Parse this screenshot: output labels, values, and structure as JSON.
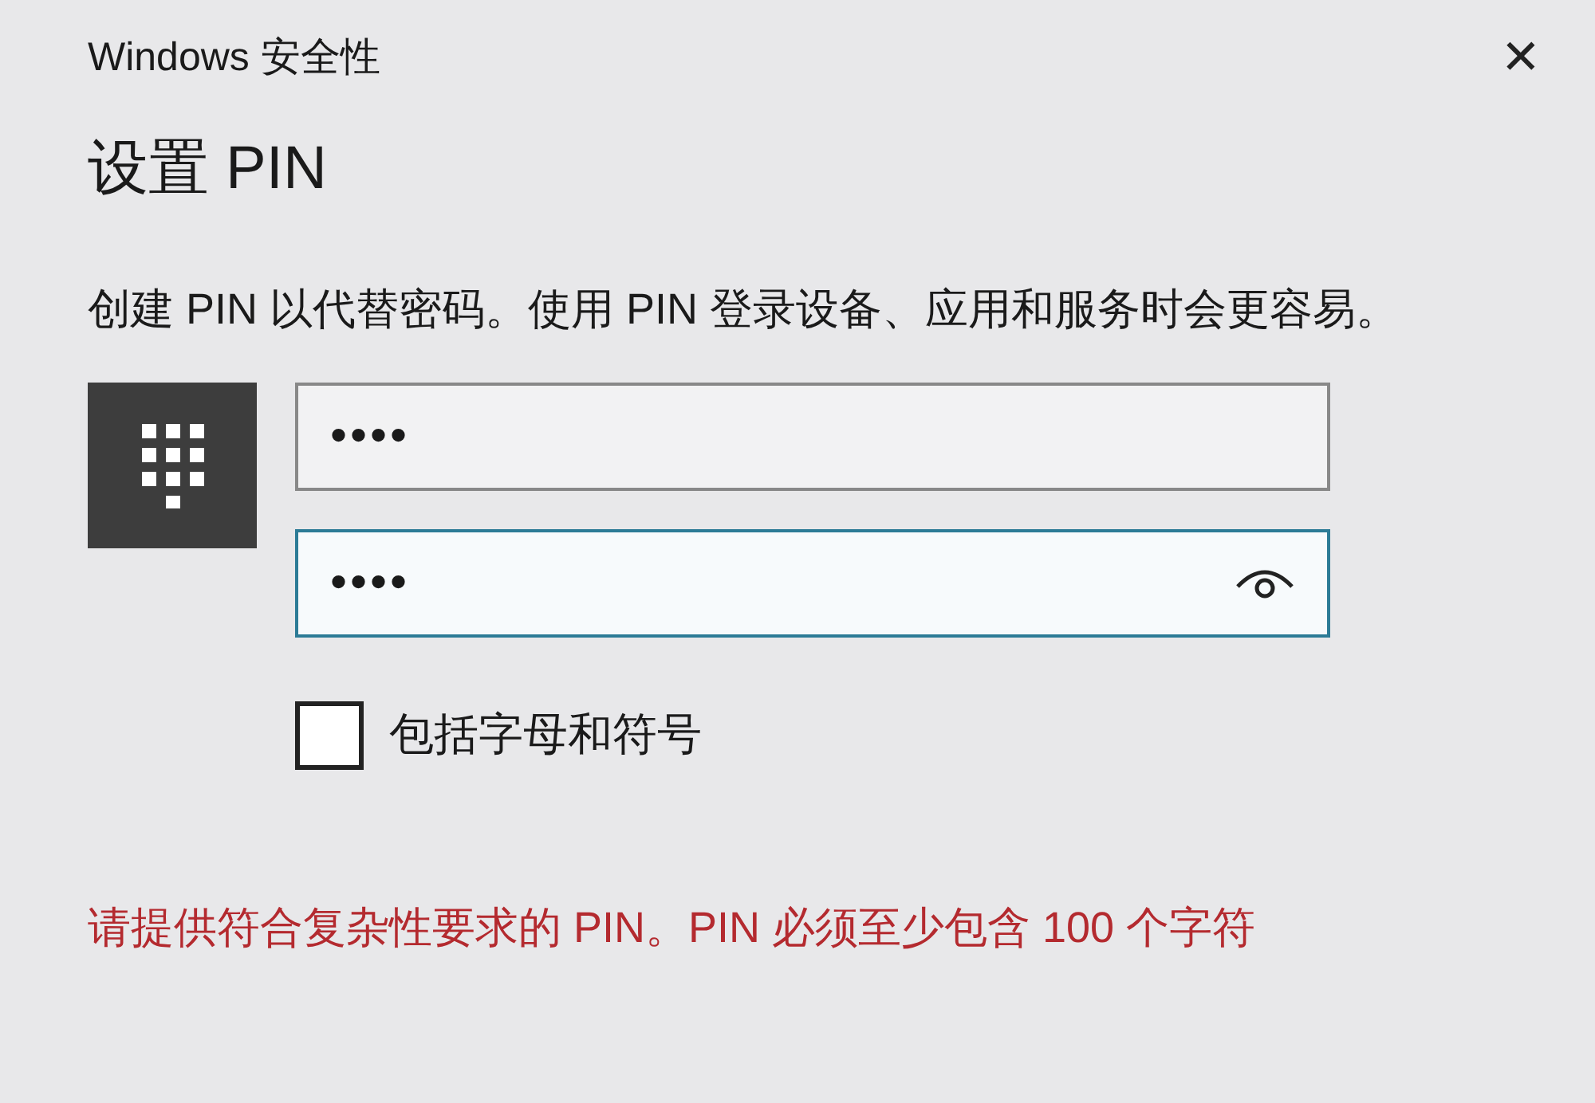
{
  "window": {
    "title": "Windows 安全性",
    "close": "✕"
  },
  "heading": "设置 PIN",
  "description": "创建 PIN 以代替密码。使用 PIN 登录设备、应用和服务时会更容易。",
  "fields": [
    {
      "value": "••••",
      "focused": false,
      "reveal": false
    },
    {
      "value": "••••",
      "focused": true,
      "reveal": true
    }
  ],
  "checkbox": {
    "label": "包括字母和符号",
    "checked": false
  },
  "error": "请提供符合复杂性要求的 PIN。PIN 必须至少包含 100 个字符"
}
